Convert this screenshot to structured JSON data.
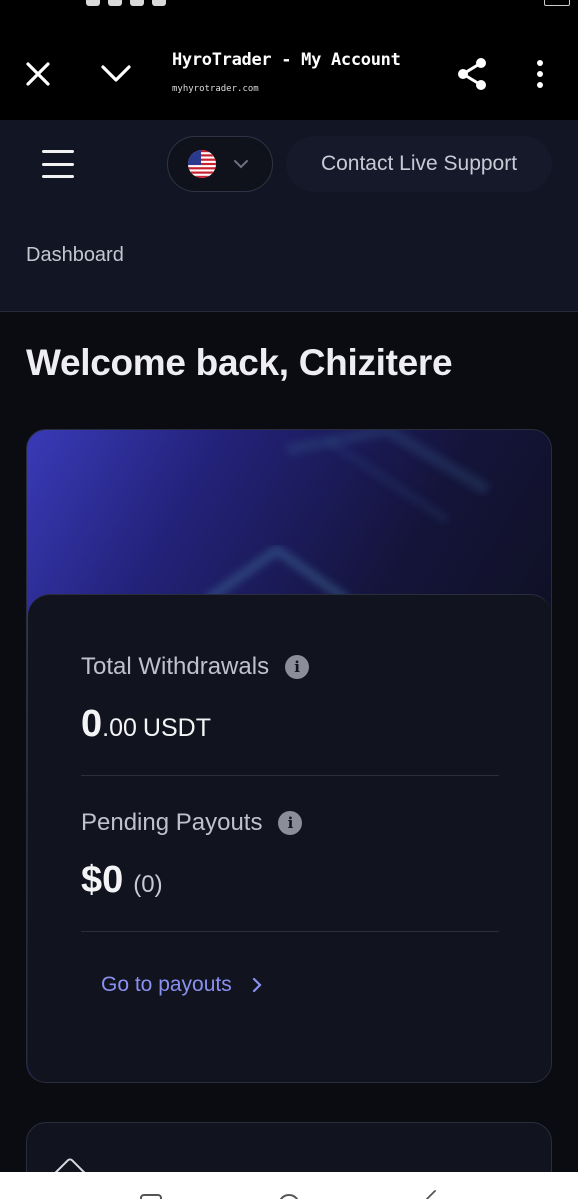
{
  "browser": {
    "tab_title": "HyroTrader - My Account",
    "url": "myhyrotrader.com"
  },
  "header": {
    "language_flag": "us-flag-icon",
    "support_label": "Contact Live Support",
    "breadcrumb": "Dashboard"
  },
  "main": {
    "welcome": "Welcome back, Chizitere",
    "total_withdrawals": {
      "label": "Total Withdrawals",
      "value_int": "0",
      "value_dec": ".00",
      "currency": "USDT"
    },
    "pending_payouts": {
      "label": "Pending Payouts",
      "value": "$0",
      "count": "(0)"
    },
    "payouts_link": "Go to payouts"
  },
  "colors": {
    "accent_link": "#8a90f0",
    "header_bg": "#121524",
    "page_bg": "#0b0c12",
    "card_bg": "#11131e"
  }
}
